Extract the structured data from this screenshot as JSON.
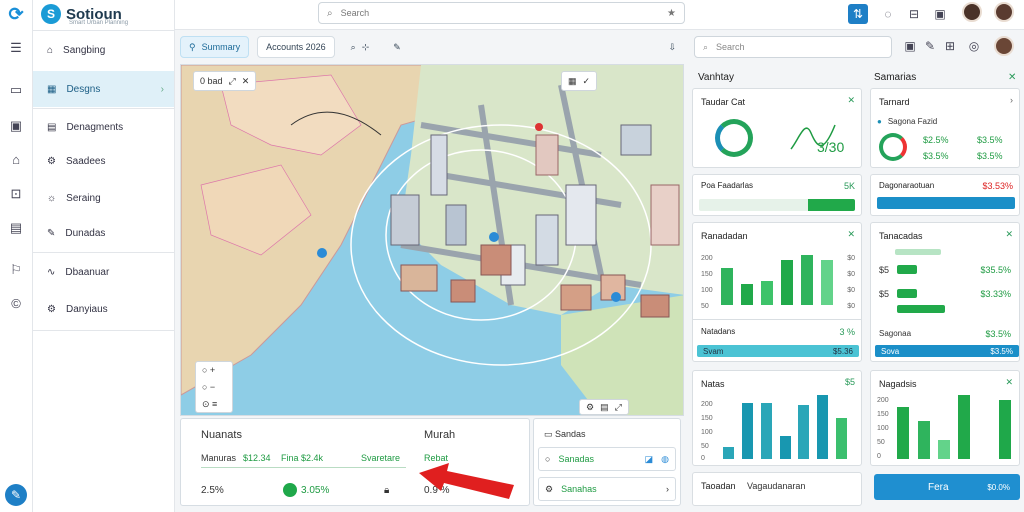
{
  "app": {
    "name": "Sotioun",
    "tagline": "Smart Urban Planning"
  },
  "search": {
    "placeholder": "Search"
  },
  "nav": [
    {
      "label": "Sangbing"
    },
    {
      "label": "Desgns"
    },
    {
      "label": "Denagments"
    },
    {
      "label": "Saadees"
    },
    {
      "label": "Seraing"
    },
    {
      "label": "Dunadas"
    },
    {
      "label": "Dbaanuar"
    },
    {
      "label": "Danyiaus"
    }
  ],
  "toolbar": {
    "chip1": "Summary",
    "chip2": "Accounts 2026"
  },
  "map": {
    "chip": "0 bad"
  },
  "bottom": {
    "title": "Nuanats",
    "col2_title": "Murah",
    "labels": [
      "Manuras",
      "$12.34",
      "Fina $2.4k",
      "Svaretare",
      "Rebat"
    ],
    "value1": "2.5%",
    "value2": "3.05%",
    "value3": "0.9 %"
  },
  "bottomright": {
    "title": "Sandas",
    "row1": "Sanadas",
    "row2": "Sanahas"
  },
  "right_search": {
    "placeholder": "Search"
  },
  "colA": {
    "header": "Vanhtay",
    "card1": {
      "title": "Taudar Cat",
      "value": "3/30"
    },
    "card2": {
      "title": "Poa Faadarlas",
      "value": "5K"
    },
    "card3": {
      "title": "Ranadadan",
      "axis": [
        "200",
        "150",
        "100",
        "50"
      ],
      "axisR": [
        "$0",
        "$0",
        "$0",
        "$0"
      ],
      "values": [
        78,
        45,
        50,
        95,
        105,
        95
      ]
    },
    "card4": {
      "title": "Natadans",
      "value": "3 %",
      "strip": "Svam",
      "strip_val": "$5.36"
    },
    "card5": {
      "title": "Natas",
      "axis": [
        "200",
        "150",
        "100",
        "50",
        "0"
      ],
      "values": [
        30,
        145,
        145,
        60,
        140,
        165,
        105
      ],
      "badge": "$5"
    },
    "card6": {
      "title": "Taoadan",
      "sub": "Vagaudanaran"
    }
  },
  "colB": {
    "header": "Samarias",
    "card1": {
      "title": "Tarnard",
      "sub": "Sagona Fazid",
      "v1": "$2.5%",
      "v2": "$3.5%",
      "v3": "$3.5%",
      "v4": "$3.5%"
    },
    "card2": {
      "title": "Dagonaraotuan",
      "value": "$3.53%"
    },
    "card3": {
      "title": "Tanacadas",
      "rows": [
        {
          "label": "$5",
          "value": "$35.5%"
        },
        {
          "label": "$5",
          "value": "$3.33%"
        },
        {
          "label": "Sagonaa",
          "value": "$3.5%"
        }
      ],
      "strip": "Sova",
      "strip_val": "$3.5%"
    },
    "card4": {
      "title": "Nagadsis",
      "axis": [
        "200",
        "150",
        "100",
        "50",
        "0"
      ],
      "values": [
        110,
        80,
        40,
        135,
        0,
        125
      ]
    },
    "action": {
      "label": "Fera",
      "sub": "$0.0%"
    }
  }
}
